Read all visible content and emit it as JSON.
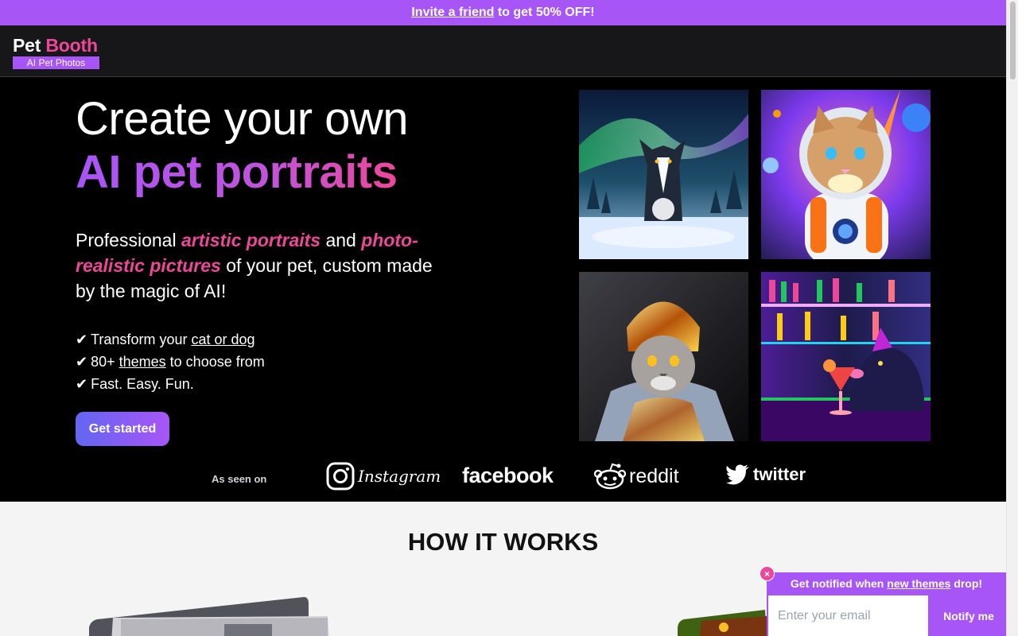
{
  "banner": {
    "link": "Invite a friend",
    "text": " to get 50% OFF!"
  },
  "logo": {
    "word1": "Pet ",
    "word2": "Booth",
    "tagline": "AI Pet Photos"
  },
  "hero": {
    "title_line1": "Create your own",
    "title_line2": "AI pet portraits",
    "lead": {
      "p1": "Professional ",
      "h1": "artistic portraits",
      "p2": " and ",
      "h2": "photo-realistic pictures",
      "p3": " of your pet, custom made by the magic of AI!"
    },
    "checks": [
      {
        "mark": "✔",
        "pre": "Transform your ",
        "link": "cat or dog",
        "post": ""
      },
      {
        "mark": "✔",
        "pre": "80+ ",
        "link": "themes",
        "post": " to choose from"
      },
      {
        "mark": "✔",
        "pre": "Fast. Easy. Fun.",
        "link": "",
        "post": ""
      }
    ],
    "cta": "Get started",
    "gallery_icons": [
      "husky-aurora-image",
      "astronaut-cat-image",
      "knight-cat-image",
      "dog-bar-cocktail-image"
    ]
  },
  "as_seen_on": {
    "label": "As seen on",
    "brands": [
      "Instagram",
      "facebook",
      "reddit",
      "twitter"
    ]
  },
  "how": {
    "title": "HOW IT WORKS"
  },
  "popup": {
    "text_pre": "Get notified when ",
    "text_link": "new themes",
    "text_post": " drop!",
    "placeholder": "Enter your email",
    "button": "Notify me",
    "close": "×"
  },
  "colors": {
    "purple": "#a855f7",
    "pink": "#ec4899",
    "indigo": "#6366f1"
  }
}
